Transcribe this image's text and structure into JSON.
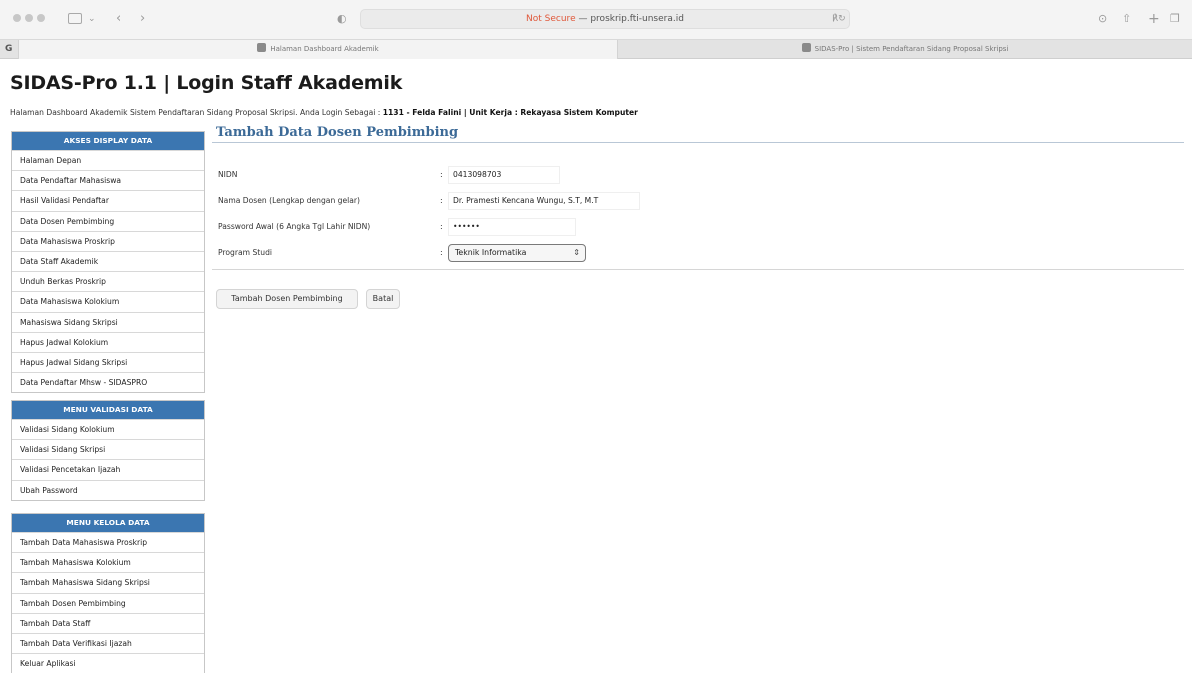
{
  "browser": {
    "address_prefix": "Not Secure",
    "address_sep": " — ",
    "address_host": "proskrip.fti-unsera.id",
    "reload_label": "℟↻",
    "tabs": [
      {
        "label": "Halaman Dashboard Akademik"
      },
      {
        "label": "SIDAS-Pro | Sistem Pendaftaran Sidang Proposal Skripsi"
      }
    ],
    "pinned_label": "G"
  },
  "header": {
    "title": "SIDAS-Pro 1.1 | Login Staff Akademik",
    "info_prefix": "Halaman Dashboard Akademik Sistem Pendaftaran Sidang Proposal Skripsi. Anda Login Sebagai : ",
    "info_user": "1131 - Felda Falini | Unit Kerja : Rekayasa Sistem Komputer"
  },
  "sidebar": {
    "sections": [
      {
        "heading": "AKSES DISPLAY DATA",
        "items": [
          "Halaman Depan",
          "Data Pendaftar Mahasiswa",
          "Hasil Validasi Pendaftar",
          "Data Dosen Pembimbing",
          "Data Mahasiswa Proskrip",
          "Data Staff Akademik",
          "Unduh Berkas Proskrip",
          "Data Mahasiswa Kolokium",
          "Mahasiswa Sidang Skripsi",
          "Hapus Jadwal Kolokium",
          "Hapus Jadwal Sidang Skripsi",
          "Data Pendaftar Mhsw - SIDASPRO"
        ]
      },
      {
        "heading": "MENU VALIDASI DATA",
        "items": [
          "Validasi Sidang Kolokium",
          "Validasi Sidang Skripsi",
          "Validasi Pencetakan Ijazah",
          "Ubah Password"
        ]
      },
      {
        "heading": "MENU KELOLA DATA",
        "items": [
          "Tambah Data Mahasiswa Proskrip",
          "Tambah Mahasiswa Kolokium",
          "Tambah Mahasiswa Sidang Skripsi",
          "Tambah Dosen Pembimbing",
          "Tambah Data Staff",
          "Tambah Data Verifikasi Ijazah",
          "Keluar Aplikasi"
        ]
      }
    ]
  },
  "form": {
    "title": "Tambah Data Dosen Pembimbing",
    "colon": ":",
    "nidn": {
      "label": "NIDN",
      "value": "0413098703"
    },
    "nama": {
      "label": "Nama Dosen (Lengkap dengan gelar)",
      "value": "Dr. Pramesti Kencana Wungu, S.T, M.T"
    },
    "password": {
      "label": "Password Awal (6 Angka Tgl Lahir NIDN)",
      "value": "••••••"
    },
    "prodi": {
      "label": "Program Studi",
      "selected": "Teknik Informatika"
    },
    "submit_label": "Tambah Dosen Pembimbing",
    "cancel_label": "Batal"
  }
}
